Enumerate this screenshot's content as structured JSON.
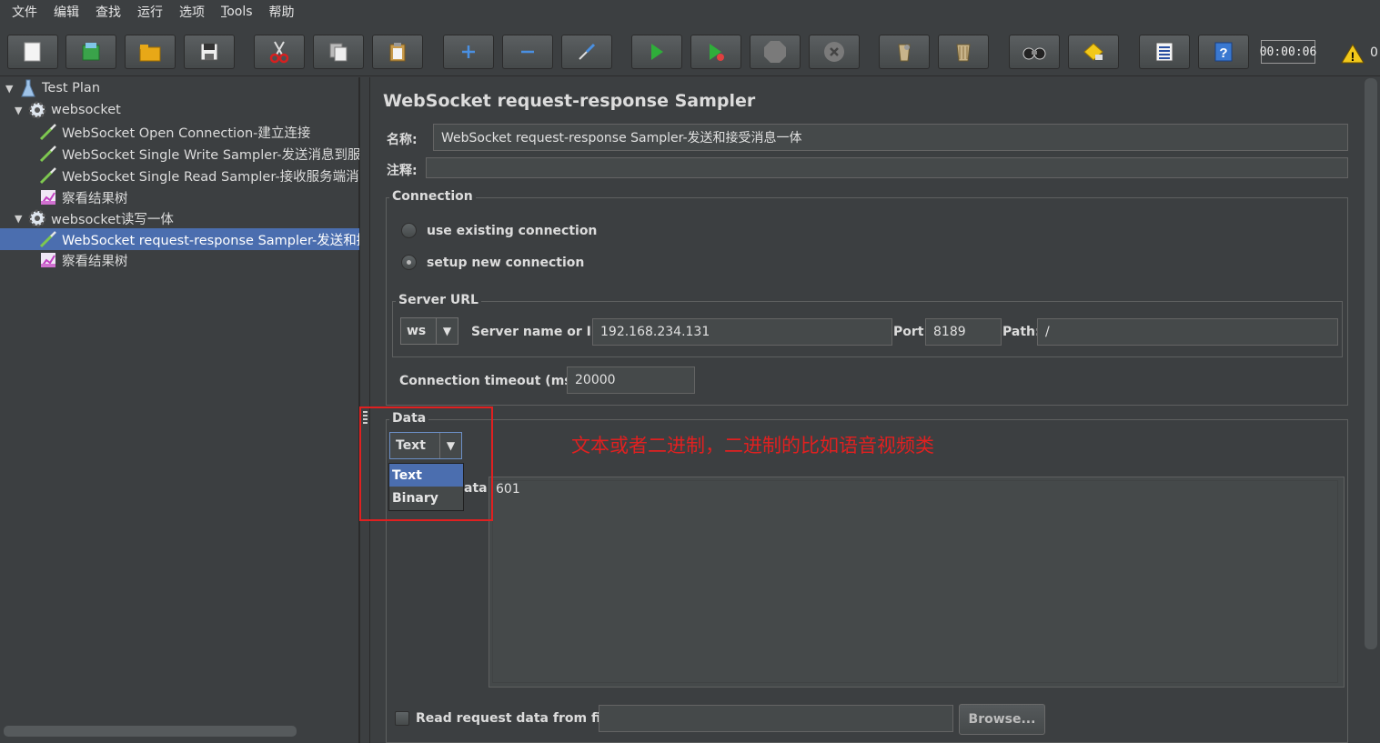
{
  "menu": {
    "items": [
      {
        "label": "文件"
      },
      {
        "label": "编辑"
      },
      {
        "label": "查找"
      },
      {
        "label": "运行"
      },
      {
        "label": "选项"
      },
      {
        "label": "Tools"
      },
      {
        "label": "帮助"
      }
    ]
  },
  "toolbar": {
    "timer": "00:00:06",
    "warning_count": "0",
    "icons": [
      "new-icon",
      "templates-icon",
      "open-icon",
      "save-icon",
      "cut-icon",
      "copy-icon",
      "paste-icon",
      "expand-icon",
      "collapse-icon",
      "toggle-icon",
      "start-icon",
      "start-no-pause-icon",
      "stop-icon",
      "shutdown-icon",
      "clear-icon",
      "clear-all-icon",
      "search-icon",
      "reset-search-icon",
      "function-helper-icon",
      "help-icon",
      "warning-icon"
    ]
  },
  "tree": {
    "items": [
      {
        "label": "Test Plan",
        "icon": "test-plan-icon"
      },
      {
        "label": "websocket",
        "icon": "thread-group-gear-icon"
      },
      {
        "label": "WebSocket Open Connection-建立连接",
        "icon": "sampler-pipette-icon"
      },
      {
        "label": "WebSocket Single Write Sampler-发送消息到服务",
        "icon": "sampler-pipette-icon"
      },
      {
        "label": "WebSocket Single Read Sampler-接收服务端消息",
        "icon": "sampler-pipette-icon"
      },
      {
        "label": "察看结果树",
        "icon": "listener-chart-icon"
      },
      {
        "label": "websocket读写一体",
        "icon": "thread-group-gear-icon"
      },
      {
        "label": "WebSocket request-response Sampler-发送和接受",
        "icon": "sampler-pipette-icon"
      },
      {
        "label": "察看结果树",
        "icon": "listener-chart-icon"
      }
    ]
  },
  "panel": {
    "title": "WebSocket request-response Sampler",
    "name_label": "名称:",
    "name_value": "WebSocket request-response Sampler-发送和接受消息一体",
    "comment_label": "注释:",
    "comment_value": ""
  },
  "connection": {
    "legend": "Connection",
    "option_existing": "use existing connection",
    "option_new": "setup new connection",
    "selected": "setup new connection"
  },
  "server_url": {
    "legend": "Server URL",
    "protocol": "ws",
    "server_label": "Server name or IP:",
    "server_value": "192.168.234.131",
    "port_label": "Port:",
    "port_value": "8189",
    "path_label": "Path:",
    "path_value": "/",
    "timeout_label": "Connection timeout (ms):",
    "timeout_value": "20000"
  },
  "data": {
    "legend": "Data",
    "type_selected": "Text",
    "options": [
      "Text",
      "Binary"
    ],
    "request_label_partial": "ata:",
    "request_value": "601",
    "read_from_file_label": "Read request data from file:",
    "file_value": "",
    "browse_label": "Browse..."
  },
  "annotation": {
    "text": "文本或者二进制，二进制的比如语音视频类",
    "color": "#e02020"
  },
  "colors": {
    "background": "#3c3f41",
    "selection": "#4b6eaf",
    "field": "#45494a"
  }
}
